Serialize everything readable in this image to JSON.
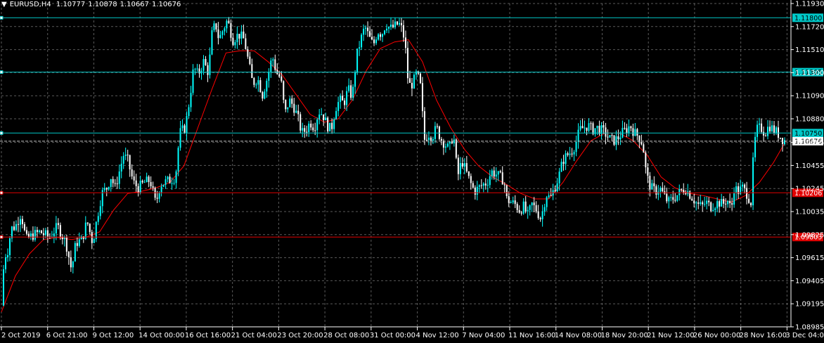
{
  "header": {
    "arrow": "▼",
    "symbol": "EURUSD,H4",
    "open": "1.10777",
    "high": "1.10878",
    "low": "1.10667",
    "close": "1.10676"
  },
  "colors": {
    "background": "#000000",
    "grid": "#808080",
    "bull_candle": "#00ffff",
    "bear_candle": "#ffffff",
    "moving_average": "#ff0000",
    "resistance_lines": "#00c8c8",
    "support_lines": "#e00000",
    "price_line": "#c0c0c0",
    "axis_text": "#ffffff"
  },
  "chart_data": {
    "type": "candlestick",
    "symbol": "EURUSD",
    "timeframe": "H4",
    "grid": true,
    "ylim": [
      1.08985,
      1.1193
    ],
    "y_ticks": [
      "1.11930",
      "1.11720",
      "1.11510",
      "1.11300",
      "1.11090",
      "1.10880",
      "1.10665",
      "1.10455",
      "1.10245",
      "1.10035",
      "1.09825",
      "1.09615",
      "1.09405",
      "1.09195",
      "1.08985"
    ],
    "x_ticks": [
      "2 Oct 2019",
      "6 Oct 21:00",
      "9 Oct 12:00",
      "14 Oct 00:00",
      "16 Oct 16:00",
      "21 Oct 04:00",
      "23 Oct 20:00",
      "28 Oct 08:00",
      "31 Oct 00:00",
      "4 Nov 12:00",
      "7 Nov 04:00",
      "11 Nov 16:00",
      "14 Nov 08:00",
      "18 Nov 20:00",
      "21 Nov 12:00",
      "26 Nov 00:00",
      "28 Nov 16:00",
      "3 Dec 04:00"
    ],
    "horizontal_levels": [
      {
        "price": 1.118,
        "label": "1.11800",
        "kind": "resistance"
      },
      {
        "price": 1.11305,
        "label": "1.11305",
        "kind": "resistance"
      },
      {
        "price": 1.1075,
        "label": "1.10750",
        "kind": "resistance"
      },
      {
        "price": 1.10206,
        "label": "1.10206",
        "kind": "support"
      },
      {
        "price": 1.09803,
        "label": "1.09803",
        "kind": "support"
      }
    ],
    "current_price": {
      "value": 1.10676,
      "label": "1.10676"
    },
    "close_path": [
      [
        0,
        1.0918
      ],
      [
        4,
        1.0962
      ],
      [
        9,
        1.0968
      ],
      [
        14,
        1.0988
      ],
      [
        20,
        1.099
      ],
      [
        28,
        1.1002
      ],
      [
        35,
        1.0978
      ],
      [
        45,
        1.0982
      ],
      [
        55,
        1.0985
      ],
      [
        68,
        1.098
      ],
      [
        80,
        1.099
      ],
      [
        92,
        1.0975
      ],
      [
        100,
        1.095
      ],
      [
        106,
        1.0975
      ],
      [
        115,
        1.0978
      ],
      [
        122,
        1.0995
      ],
      [
        130,
        1.0975
      ],
      [
        137,
        1.1
      ],
      [
        143,
        1.102
      ],
      [
        150,
        1.1025
      ],
      [
        156,
        1.1035
      ],
      [
        162,
        1.1025
      ],
      [
        168,
        1.104
      ],
      [
        174,
        1.1055
      ],
      [
        180,
        1.105
      ],
      [
        188,
        1.103
      ],
      [
        195,
        1.1025
      ],
      [
        204,
        1.103
      ],
      [
        212,
        1.1032
      ],
      [
        220,
        1.101
      ],
      [
        226,
        1.1028
      ],
      [
        232,
        1.103
      ],
      [
        240,
        1.1032
      ],
      [
        248,
        1.1035
      ],
      [
        254,
        1.1075
      ],
      [
        262,
        1.108
      ],
      [
        268,
        1.1105
      ],
      [
        274,
        1.1135
      ],
      [
        280,
        1.1128
      ],
      [
        288,
        1.114
      ],
      [
        295,
        1.113
      ],
      [
        300,
        1.1165
      ],
      [
        305,
        1.1175
      ],
      [
        310,
        1.116
      ],
      [
        315,
        1.1168
      ],
      [
        322,
        1.1178
      ],
      [
        330,
        1.116
      ],
      [
        338,
        1.1165
      ],
      [
        346,
        1.116
      ],
      [
        352,
        1.114
      ],
      [
        358,
        1.112
      ],
      [
        365,
        1.1125
      ],
      [
        372,
        1.111
      ],
      [
        380,
        1.1128
      ],
      [
        386,
        1.1145
      ],
      [
        392,
        1.113
      ],
      [
        398,
        1.1125
      ],
      [
        404,
        1.1092
      ],
      [
        410,
        1.1105
      ],
      [
        416,
        1.11
      ],
      [
        422,
        1.109
      ],
      [
        428,
        1.1075
      ],
      [
        434,
        1.1078
      ],
      [
        440,
        1.1085
      ],
      [
        446,
        1.108
      ],
      [
        452,
        1.1095
      ],
      [
        458,
        1.1092
      ],
      [
        464,
        1.1082
      ],
      [
        470,
        1.1078
      ],
      [
        476,
        1.1098
      ],
      [
        482,
        1.1105
      ],
      [
        488,
        1.1102
      ],
      [
        494,
        1.1115
      ],
      [
        500,
        1.1108
      ],
      [
        506,
        1.1145
      ],
      [
        512,
        1.116
      ],
      [
        518,
        1.1172
      ],
      [
        524,
        1.1162
      ],
      [
        530,
        1.1155
      ],
      [
        536,
        1.1168
      ],
      [
        542,
        1.1165
      ],
      [
        548,
        1.1175
      ],
      [
        554,
        1.117
      ],
      [
        560,
        1.1172
      ],
      [
        566,
        1.1175
      ],
      [
        572,
        1.1168
      ],
      [
        576,
        1.115
      ],
      [
        580,
        1.1118
      ],
      [
        586,
        1.112
      ],
      [
        592,
        1.113
      ],
      [
        598,
        1.1115
      ],
      [
        602,
        1.1068
      ],
      [
        608,
        1.1075
      ],
      [
        614,
        1.1072
      ],
      [
        620,
        1.108
      ],
      [
        626,
        1.107
      ],
      [
        632,
        1.1065
      ],
      [
        638,
        1.106
      ],
      [
        644,
        1.1075
      ],
      [
        650,
        1.1035
      ],
      [
        656,
        1.105
      ],
      [
        662,
        1.104
      ],
      [
        668,
        1.103
      ],
      [
        674,
        1.1022
      ],
      [
        680,
        1.1025
      ],
      [
        686,
        1.1028
      ],
      [
        692,
        1.103
      ],
      [
        698,
        1.104
      ],
      [
        704,
        1.1038
      ],
      [
        710,
        1.1035
      ],
      [
        716,
        1.1032
      ],
      [
        720,
        1.1015
      ],
      [
        726,
        1.1012
      ],
      [
        732,
        1.101
      ],
      [
        738,
        1.1005
      ],
      [
        744,
        1.1008
      ],
      [
        750,
        1.1
      ],
      [
        756,
        1.101
      ],
      [
        762,
        1.1005
      ],
      [
        768,
        1.0998
      ],
      [
        772,
        1.1005
      ],
      [
        776,
        1.102
      ],
      [
        782,
        1.1015
      ],
      [
        788,
        1.1025
      ],
      [
        794,
        1.1035
      ],
      [
        800,
        1.105
      ],
      [
        806,
        1.1055
      ],
      [
        812,
        1.1058
      ],
      [
        818,
        1.1065
      ],
      [
        824,
        1.1078
      ],
      [
        830,
        1.108
      ],
      [
        836,
        1.1082
      ],
      [
        842,
        1.1078
      ],
      [
        848,
        1.108
      ],
      [
        854,
        1.1078
      ],
      [
        860,
        1.1075
      ],
      [
        866,
        1.107
      ],
      [
        872,
        1.1068
      ],
      [
        878,
        1.107
      ],
      [
        884,
        1.1075
      ],
      [
        890,
        1.1078
      ],
      [
        896,
        1.1082
      ],
      [
        902,
        1.1075
      ],
      [
        908,
        1.1072
      ],
      [
        914,
        1.1065
      ],
      [
        918,
        1.1042
      ],
      [
        922,
        1.103
      ],
      [
        926,
        1.1025
      ],
      [
        932,
        1.1022
      ],
      [
        938,
        1.1025
      ],
      [
        944,
        1.1018
      ],
      [
        950,
        1.1012
      ],
      [
        956,
        1.1015
      ],
      [
        962,
        1.1018
      ],
      [
        968,
        1.1022
      ],
      [
        974,
        1.1025
      ],
      [
        980,
        1.102
      ],
      [
        986,
        1.1015
      ],
      [
        992,
        1.101
      ],
      [
        998,
        1.1008
      ],
      [
        1004,
        1.1012
      ],
      [
        1010,
        1.1008
      ],
      [
        1016,
        1.101
      ],
      [
        1022,
        1.1012
      ],
      [
        1028,
        1.101
      ],
      [
        1034,
        1.1015
      ],
      [
        1040,
        1.1005
      ],
      [
        1044,
        1.1025
      ],
      [
        1050,
        1.1022
      ],
      [
        1056,
        1.1025
      ],
      [
        1062,
        1.102
      ],
      [
        1068,
        1.1012
      ],
      [
        1072,
        1.106
      ],
      [
        1076,
        1.1078
      ],
      [
        1082,
        1.108
      ],
      [
        1088,
        1.1075
      ],
      [
        1094,
        1.1082
      ],
      [
        1100,
        1.1078
      ],
      [
        1106,
        1.1075
      ],
      [
        1112,
        1.107
      ],
      [
        1118,
        1.10676
      ]
    ],
    "moving_average_path": [
      [
        0,
        1.0912
      ],
      [
        20,
        1.0945
      ],
      [
        40,
        1.0965
      ],
      [
        60,
        1.0978
      ],
      [
        80,
        1.098
      ],
      [
        100,
        1.0978
      ],
      [
        120,
        1.098
      ],
      [
        140,
        1.0985
      ],
      [
        160,
        1.1005
      ],
      [
        180,
        1.102
      ],
      [
        200,
        1.1022
      ],
      [
        220,
        1.1025
      ],
      [
        240,
        1.103
      ],
      [
        260,
        1.1045
      ],
      [
        280,
        1.108
      ],
      [
        300,
        1.1115
      ],
      [
        320,
        1.1148
      ],
      [
        340,
        1.115
      ],
      [
        360,
        1.115
      ],
      [
        380,
        1.114
      ],
      [
        400,
        1.1128
      ],
      [
        420,
        1.111
      ],
      [
        440,
        1.1092
      ],
      [
        460,
        1.1085
      ],
      [
        480,
        1.1088
      ],
      [
        500,
        1.1105
      ],
      [
        520,
        1.1132
      ],
      [
        540,
        1.1152
      ],
      [
        560,
        1.1158
      ],
      [
        580,
        1.116
      ],
      [
        600,
        1.114
      ],
      [
        620,
        1.1105
      ],
      [
        640,
        1.108
      ],
      [
        660,
        1.106
      ],
      [
        680,
        1.1045
      ],
      [
        700,
        1.1035
      ],
      [
        720,
        1.1028
      ],
      [
        740,
        1.102
      ],
      [
        760,
        1.1015
      ],
      [
        780,
        1.1015
      ],
      [
        800,
        1.103
      ],
      [
        820,
        1.105
      ],
      [
        840,
        1.1068
      ],
      [
        860,
        1.1075
      ],
      [
        880,
        1.1075
      ],
      [
        900,
        1.1068
      ],
      [
        920,
        1.1055
      ],
      [
        940,
        1.1035
      ],
      [
        960,
        1.1025
      ],
      [
        980,
        1.102
      ],
      [
        1000,
        1.1018
      ],
      [
        1020,
        1.1015
      ],
      [
        1040,
        1.1012
      ],
      [
        1060,
        1.1018
      ],
      [
        1080,
        1.103
      ],
      [
        1100,
        1.1048
      ],
      [
        1118,
        1.1068
      ]
    ]
  }
}
